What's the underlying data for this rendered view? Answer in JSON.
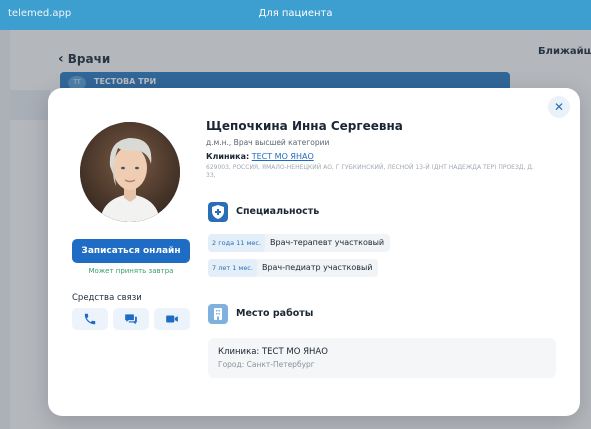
{
  "topbar": {
    "brand": "telemed.app",
    "center_title": "Для пациента"
  },
  "background": {
    "back_label": "Врачи",
    "right_title": "Ближайш",
    "card_initials": "ТТ",
    "card_name": "ТЕСТОВА ТРИ"
  },
  "doctor": {
    "name": "Щепочкина Инна Сергеевна",
    "degree": "д.м.н., Врач высшей категории",
    "clinic_label": "Клиника:",
    "clinic_name": "ТЕСТ МО ЯНАО",
    "address": "629003, РОССИЯ, ЯМАЛО-НЕНЕЦКИЙ АО, Г ГУБКИНСКИЙ, ЛЕСНОЙ 13-Й (ДНТ НАДЕЖДА ТЕР) ПРОЕЗД, Д. 33,"
  },
  "booking": {
    "button_label": "Записаться онлайн",
    "hint": "Может принять завтра"
  },
  "communication": {
    "label": "Средства связи",
    "channels": [
      "phone-icon",
      "chat-icon",
      "video-icon"
    ]
  },
  "specialty": {
    "title": "Специальность",
    "items": [
      {
        "experience": "2 года 11 мес.",
        "role": "Врач-терапевт участковый"
      },
      {
        "experience": "7 лет 1 мес.",
        "role": "Врач-педиатр участковый"
      }
    ]
  },
  "workplace": {
    "title": "Место работы",
    "clinic": "Клиника: ТЕСТ МО ЯНАО",
    "city": "Город: Санкт-Петербург"
  },
  "colors": {
    "primary": "#1e6cc4",
    "topbar": "#3d9fcf",
    "success": "#3aa16c"
  }
}
